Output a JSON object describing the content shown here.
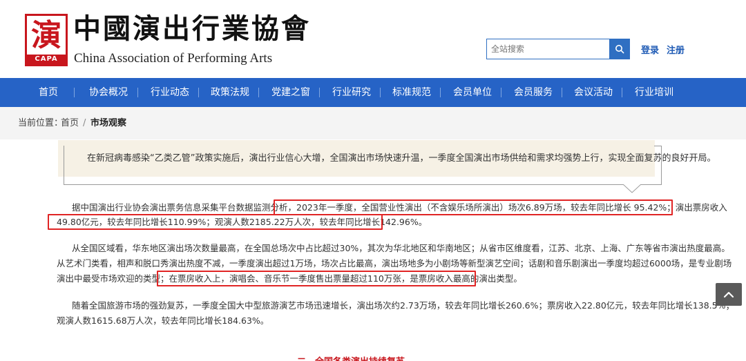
{
  "brand": {
    "seal_glyph": "演",
    "seal_abbr": "CAPA",
    "name_cn": "中國演出行業協會",
    "name_en": "China Association of Performing Arts"
  },
  "search": {
    "placeholder": "全站搜索",
    "icon": "search-icon"
  },
  "auth": {
    "login": "登录",
    "register": "注册"
  },
  "nav": [
    "首页",
    "协会概况",
    "行业动态",
    "政策法规",
    "党建之窗",
    "行业研究",
    "标准规范",
    "会员单位",
    "会员服务",
    "会议活动",
    "行业培训"
  ],
  "breadcrumb": {
    "prefix": "当前位置：",
    "home": "首页",
    "separator": "/",
    "current": "市场观察"
  },
  "summary": "在新冠病毒感染“乙类乙管”政策实施后，演出行业信心大增，全国演出市场快速升温，一季度全国演出市场供给和需求均强势上行，实现全面复苏的良好开局。",
  "article": {
    "p1_line1_lead": "据中国演出行业协会演出票务信息采集平台数据监测分析，",
    "p1_line1_hl": "2023年一季度，全国营业性演出（不含娱乐场所演出）场次6.89万场，较去年同比增长 95.42%；演出票房收入",
    "p1_line2_hl": "49.80亿元，较去年同比增长110.99%；观演人数2185.22万人次，较去年同比增长142.96%。",
    "p2_line1": "从全国区域看，华东地区演出场次数量最高，在全国总场次中占比超过30%，其次为华北地区和华南地区；从省市区维度看，江苏、北京、上海、广东等省市演出热度最高。",
    "p2_line2": "从艺术门类看，相声和脱口秀演出热度不减，一季度演出超过1万场，场次占比最高，演出场地多为小剧场等新型演艺空间；话剧和音乐剧演出一季度均超过6000场，是专业剧场",
    "p2_line3_lead": "演出中最受市场欢迎的类型；",
    "p2_line3_hl": "在票房收入上，演唱会、音乐节一季度售出票量超过110万张，是票房收入最高的演出类型。",
    "p3_line1": "随着全国旅游市场的强劲复苏，一季度全国大中型旅游演艺市场迅速增长，演出场次约2.73万场，较去年同比增长260.6%；票房收入22.80亿元，较去年同比增长138.5%；",
    "p3_line2": "观演人数1615.68万人次，较去年同比增长184.63%。",
    "next_heading": "二、全国各类演出持续复苏"
  },
  "back_to_top_icon": "chevron-up-icon",
  "colors": {
    "brand_red": "#c8161d",
    "nav_blue": "#2663c6",
    "link_blue": "#1f5bb5",
    "highlight_red": "#e02424",
    "summary_bg": "#f6f1e5"
  }
}
